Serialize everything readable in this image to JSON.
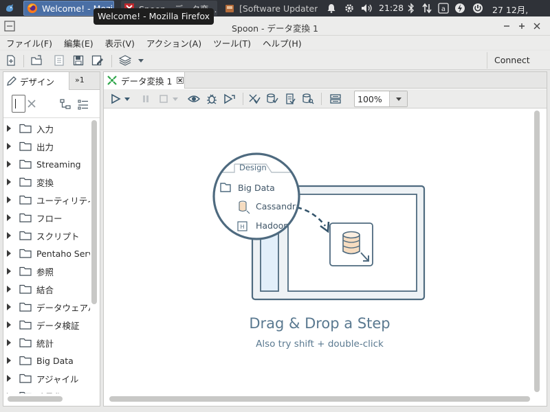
{
  "panel": {
    "tasks": [
      {
        "label": "Welcome! - Mozill"
      },
      {
        "label": "Spoon - データ変..."
      },
      {
        "label": "[Software Updater]"
      }
    ],
    "time": "21:28",
    "date_time": "27 12月, 21:28"
  },
  "tooltip": "Welcome! - Mozilla Firefox",
  "window": {
    "title": "Spoon - データ変換 1"
  },
  "menu": [
    "ファイル(F)",
    "編集(E)",
    "表示(V)",
    "アクション(A)",
    "ツール(T)",
    "ヘルプ(H)"
  ],
  "toolbar": {
    "connect_label": "Connect"
  },
  "left": {
    "tab_design": "デザイン",
    "tab_more": "»1",
    "tree": [
      "入力",
      "出力",
      "Streaming",
      "変換",
      "ユーティリティ",
      "フロー",
      "スクリプト",
      "Pentaho Server",
      "参照",
      "結合",
      "データウェアハウス",
      "データ検証",
      "統計",
      "Big Data",
      "アジャイル",
      "暗号化"
    ]
  },
  "main": {
    "tab_label": "データ変換 1",
    "zoom": "100%",
    "hint_title": "Drag & Drop a Step",
    "hint_sub": "Also try shift + double-click",
    "illus_tab": "Design",
    "illus_folder": "Big Data",
    "illus_item1": "Cassandra",
    "illus_item2": "Hadoop"
  }
}
